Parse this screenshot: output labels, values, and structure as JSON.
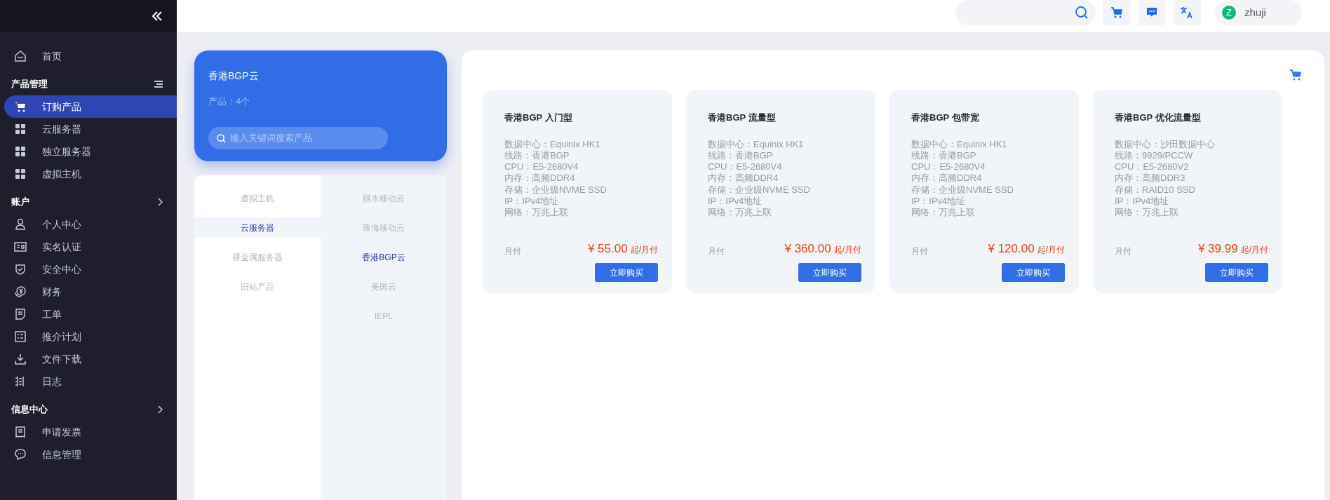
{
  "sidebar": {
    "sections": [
      {
        "items": [
          {
            "label": "首页",
            "selected": false
          }
        ]
      },
      {
        "title": "产品管理",
        "kind": "menu",
        "items": [
          {
            "label": "订购产品",
            "selected": true
          },
          {
            "label": "云服务器",
            "selected": false
          },
          {
            "label": "独立服务器",
            "selected": false
          },
          {
            "label": "虚拟主机",
            "selected": false
          }
        ]
      },
      {
        "title": "账户",
        "kind": "chevron",
        "items": [
          {
            "label": "个人中心",
            "selected": false
          },
          {
            "label": "实名认证",
            "selected": false
          },
          {
            "label": "安全中心",
            "selected": false
          },
          {
            "label": "财务",
            "selected": false
          },
          {
            "label": "工单",
            "selected": false
          },
          {
            "label": "推介计划",
            "selected": false
          },
          {
            "label": "文件下载",
            "selected": false
          },
          {
            "label": "日志",
            "selected": false
          }
        ]
      },
      {
        "title": "信息中心",
        "kind": "chevron",
        "items": [
          {
            "label": "申请发票",
            "selected": false
          },
          {
            "label": "信息管理",
            "selected": false
          }
        ]
      }
    ]
  },
  "topbar": {
    "user": {
      "initial": "Z",
      "name": "zhuji"
    }
  },
  "group_card": {
    "title": "香港BGP云",
    "count": "产品：4个",
    "search": {
      "placeholder": "输入关键词搜索产品"
    }
  },
  "categories": {
    "column_1": [
      {
        "label": "虚拟主机",
        "selected": false
      },
      {
        "label": "云服务器",
        "selected": true
      },
      {
        "label": "裸金属服务器",
        "selected": false
      },
      {
        "label": "旧站产品",
        "selected": false
      }
    ],
    "column_2": [
      {
        "label": "丽水移动云",
        "selected": false
      },
      {
        "label": "珠海移动云",
        "selected": false
      },
      {
        "label": "香港BGP云",
        "selected": true
      },
      {
        "label": "美国云",
        "selected": false
      },
      {
        "label": "IEPL",
        "selected": false
      }
    ]
  },
  "products": [
    {
      "title": "香港BGP 入门型",
      "specs": [
        "数据中心：Equinix HK1",
        "线路：香港BGP",
        "CPU：E5-2680V4",
        "内存：高频DDR4",
        "存储：企业级NVME SSD",
        "IP：IPv4地址",
        "网络：万兆上联"
      ],
      "billing": "月付",
      "price": "¥ 55.00",
      "unit": "起/月付",
      "button": "立即购买"
    },
    {
      "title": "香港BGP 流量型",
      "specs": [
        "数据中心：Equinix HK1",
        "线路：香港BGP",
        "CPU：E5-2680V4",
        "内存：高频DDR4",
        "存储：企业级NVME SSD",
        "IP：IPv4地址",
        "网络：万兆上联"
      ],
      "billing": "月付",
      "price": "¥ 360.00",
      "unit": "起/月付",
      "button": "立即购买"
    },
    {
      "title": "香港BGP 包带宽",
      "specs": [
        "数据中心：Equinix HK1",
        "线路：香港BGP",
        "CPU：E5-2680V4",
        "内存：高频DDR4",
        "存储：企业级NVME SSD",
        "IP：IPv4地址",
        "网络：万兆上联"
      ],
      "billing": "月付",
      "price": "¥ 120.00",
      "unit": "起/月付",
      "button": "立即购买"
    },
    {
      "title": "香港BGP 优化流量型",
      "specs": [
        "数据中心：沙田数据中心",
        "线路：9929/PCCW",
        "CPU：E5-2680V2",
        "内存：高频DDR3",
        "存储：RAID10 SSD",
        "IP：IPv4地址",
        "网络：万兆上联"
      ],
      "billing": "月付",
      "price": "¥ 39.99",
      "unit": "起/月付",
      "button": "立即购买"
    }
  ]
}
